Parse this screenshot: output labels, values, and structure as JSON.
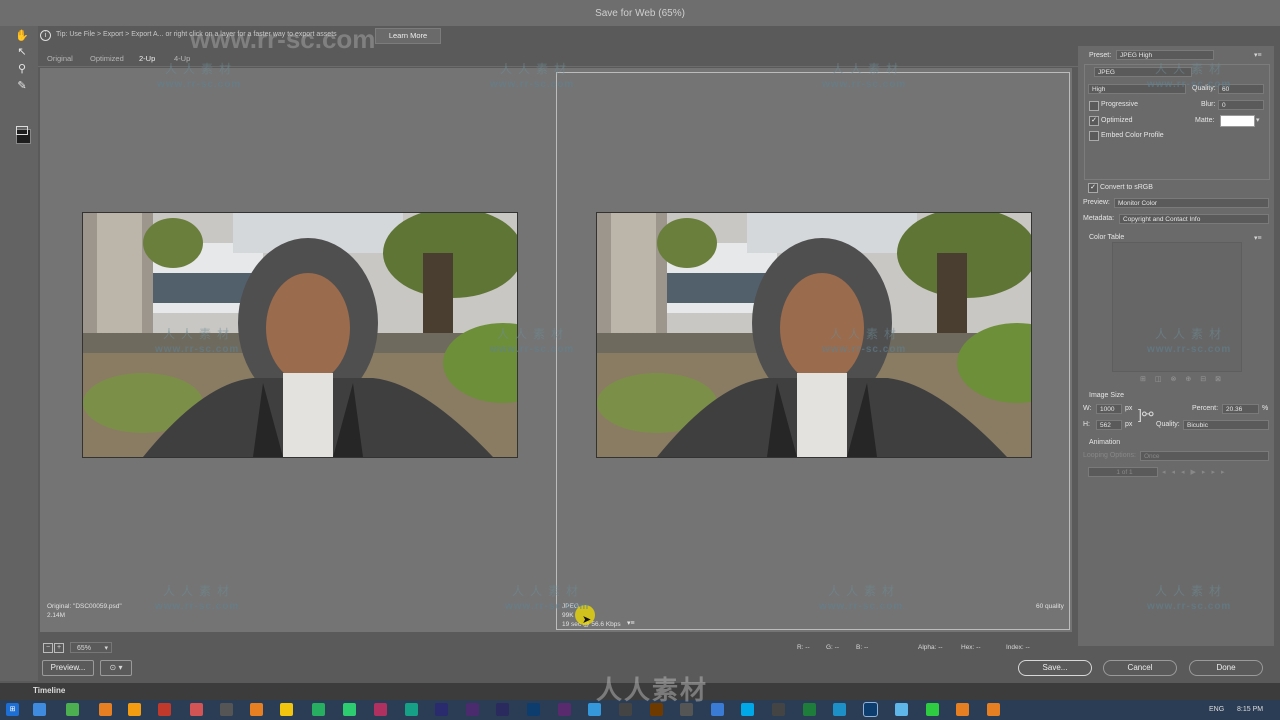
{
  "window": {
    "title": "Save for Web (65%)"
  },
  "tip": {
    "text": "Tip: Use File > Export > Export A... or right click on a layer for a faster way to export assets",
    "learn_more": "Learn More"
  },
  "tabs": [
    "Original",
    "Optimized",
    "2-Up",
    "4-Up"
  ],
  "active_tab": "2-Up",
  "left_pane": {
    "line1": "Original: \"DSC00059.psd\"",
    "line2": "2.14M"
  },
  "right_pane": {
    "line1": "JPEG",
    "line2": "99K",
    "line3": "19 sec @ 56.6 Kbps",
    "quality": "60 quality"
  },
  "zoom": {
    "value": "65%"
  },
  "readout": {
    "r": "R: --",
    "g": "G: --",
    "b": "B: --",
    "alpha": "Alpha: --",
    "hex": "Hex: --",
    "index": "Index: --"
  },
  "buttons": {
    "preview": "Preview...",
    "save": "Save...",
    "cancel": "Cancel",
    "done": "Done"
  },
  "settings": {
    "preset_label": "Preset:",
    "preset_value": "JPEG High",
    "format": "JPEG",
    "compression": "High",
    "quality_label": "Quality:",
    "quality_value": "60",
    "progressive": "Progressive",
    "blur_label": "Blur:",
    "blur_value": "0",
    "optimized": "Optimized",
    "matte_label": "Matte:",
    "embed_profile": "Embed Color Profile",
    "convert_srgb": "Convert to sRGB",
    "preview_label": "Preview:",
    "preview_value": "Monitor Color",
    "metadata_label": "Metadata:",
    "metadata_value": "Copyright and Contact Info",
    "color_table": "Color Table",
    "image_size": "Image Size",
    "w_label": "W:",
    "w_value": "1000",
    "w_unit": "px",
    "h_label": "H:",
    "h_value": "562",
    "h_unit": "px",
    "percent_label": "Percent:",
    "percent_value": "20.36",
    "percent_unit": "%",
    "resample_label": "Quality:",
    "resample_value": "Bicubic",
    "animation": "Animation",
    "looping_label": "Looping Options:",
    "looping_value": "Once",
    "frame": "1 of 1"
  },
  "timeline": {
    "label": "Timeline"
  },
  "taskbar": {
    "lang": "ENG",
    "time": "8:15 PM"
  },
  "watermark": {
    "cn": "人人素材",
    "url": "www.rr-sc.com",
    "top_url": "www.rr-sc.com",
    "bottom_brand": "人人素材"
  },
  "colors": {
    "preview_bg": "#747474",
    "panel": "#6a6a6a",
    "accent": "#f0c800"
  }
}
